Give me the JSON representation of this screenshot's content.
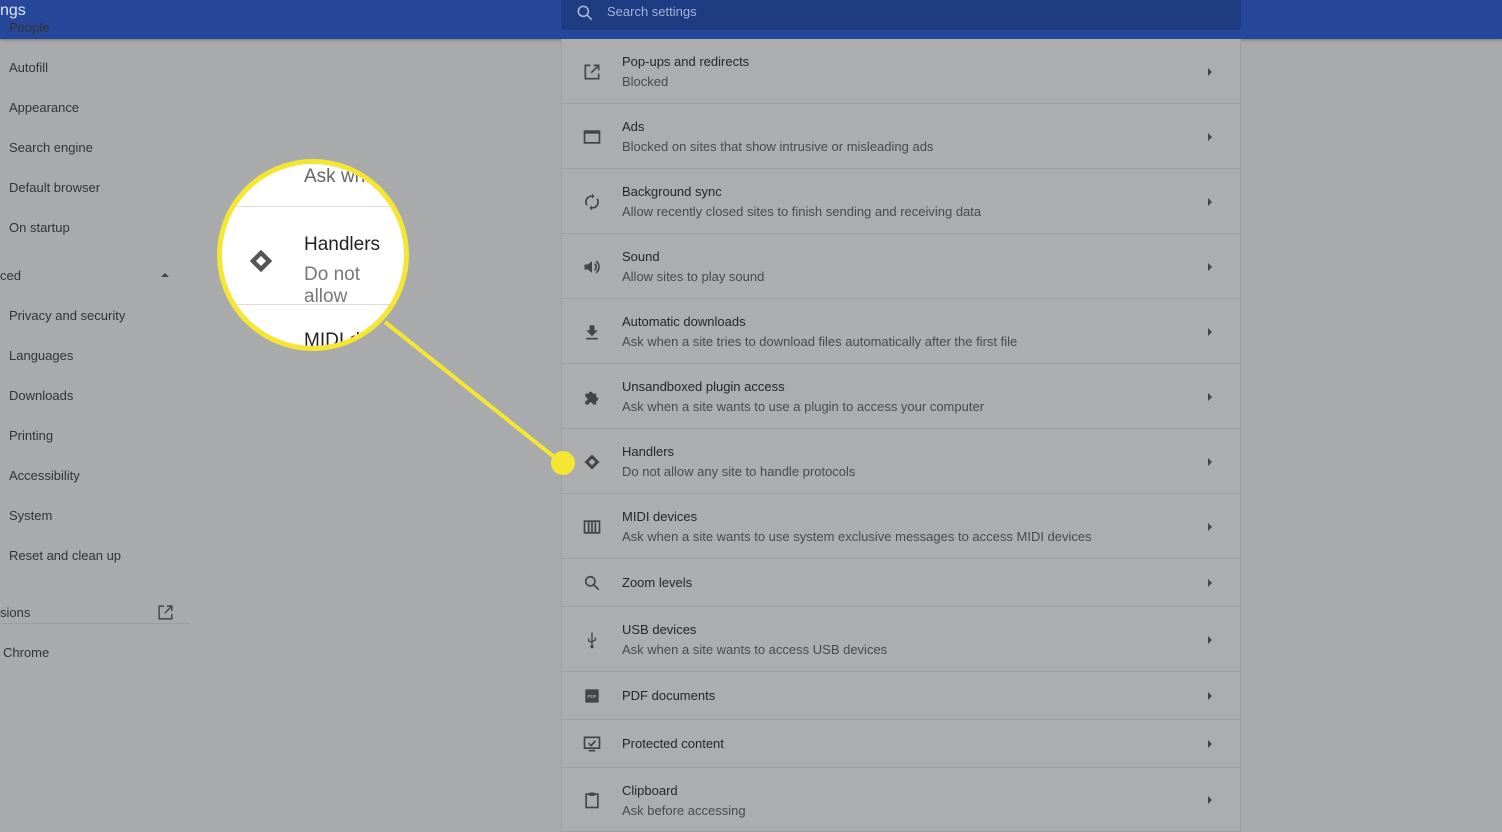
{
  "header": {
    "title": "ngs",
    "search_placeholder": "Search settings"
  },
  "sidebar": {
    "items": [
      "People",
      "Autofill",
      "Appearance",
      "Search engine",
      "Default browser",
      "On startup"
    ],
    "advanced": "ced",
    "advanced_items": [
      "Privacy and security",
      "Languages",
      "Downloads",
      "Printing",
      "Accessibility",
      "System",
      "Reset and clean up"
    ],
    "extensions": "sions",
    "about": "Chrome"
  },
  "rows": [
    {
      "title": "Pop-ups and redirects",
      "sub": "Blocked",
      "icon": "open-in-new-icon"
    },
    {
      "title": "Ads",
      "sub": "Blocked on sites that show intrusive or misleading ads",
      "icon": "window-icon"
    },
    {
      "title": "Background sync",
      "sub": "Allow recently closed sites to finish sending and receiving data",
      "icon": "sync-icon"
    },
    {
      "title": "Sound",
      "sub": "Allow sites to play sound",
      "icon": "speaker-icon"
    },
    {
      "title": "Automatic downloads",
      "sub": "Ask when a site tries to download files automatically after the first file",
      "icon": "download-icon"
    },
    {
      "title": "Unsandboxed plugin access",
      "sub": "Ask when a site wants to use a plugin to access your computer",
      "icon": "puzzle-icon"
    },
    {
      "title": "Handlers",
      "sub": "Do not allow any site to handle protocols",
      "icon": "handlers-icon"
    },
    {
      "title": "MIDI devices",
      "sub": "Ask when a site wants to use system exclusive messages to access MIDI devices",
      "icon": "piano-icon"
    },
    {
      "title": "Zoom levels",
      "sub": "",
      "icon": "search-icon"
    },
    {
      "title": "USB devices",
      "sub": "Ask when a site wants to access USB devices",
      "icon": "usb-icon"
    },
    {
      "title": "PDF documents",
      "sub": "",
      "icon": "pdf-icon"
    },
    {
      "title": "Protected content",
      "sub": "",
      "icon": "protected-content-icon"
    },
    {
      "title": "Clipboard",
      "sub": "Ask before accessing",
      "icon": "clipboard-icon"
    }
  ],
  "magnifier": {
    "above": "Ask wh",
    "title": "Handlers",
    "sub": "Do not allow",
    "below": "MIDI d"
  },
  "callout_color": "#f5e634"
}
